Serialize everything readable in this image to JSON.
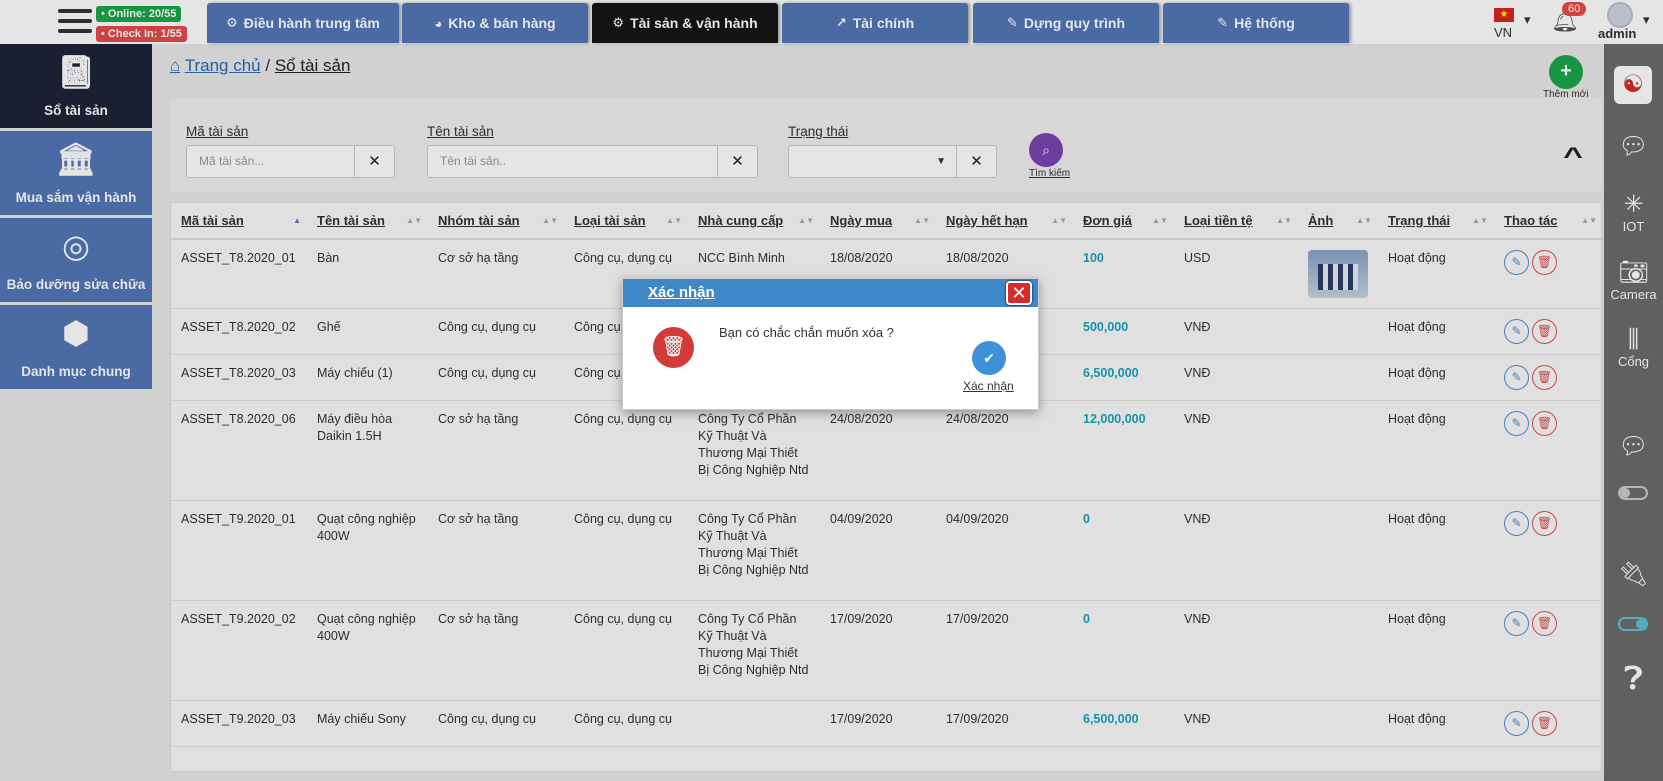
{
  "topbar": {
    "online": "• Online: 20/55",
    "checkin": "• Check In: 1/55",
    "tabs": [
      {
        "label": "Điều hành trung tâm",
        "icon": "⚙"
      },
      {
        "label": "Kho & bán hàng",
        "icon": "◕"
      },
      {
        "label": "Tài sản & vận hành",
        "icon": "⚙"
      },
      {
        "label": "Tài chính",
        "icon": "↗"
      },
      {
        "label": "Dựng quy trình",
        "icon": "✎"
      },
      {
        "label": "Hệ thống",
        "icon": "✎"
      }
    ],
    "lang": "VN",
    "notif_count": "60",
    "user": "admin"
  },
  "sidebar": {
    "items": [
      {
        "label": "Sổ tài sản",
        "icon": "book-icon"
      },
      {
        "label": "Mua sắm vận hành",
        "icon": "bank-icon"
      },
      {
        "label": "Bảo dưỡng sửa chữa",
        "icon": "lifebuoy-icon"
      },
      {
        "label": "Danh mục chung",
        "icon": "cubes-icon"
      }
    ]
  },
  "rail": {
    "iot": "IOT",
    "camera": "Camera",
    "gate": "Cổng"
  },
  "breadcrumb": {
    "home": "Trang chủ",
    "current": "Sổ tài sản"
  },
  "add": {
    "label": "Thêm mới"
  },
  "filters": {
    "code_label": "Mã tài sản",
    "code_placeholder": "Mã tài sản...",
    "name_label": "Tên tài sản",
    "name_placeholder": "Tên tài sản..",
    "status_label": "Trạng thái",
    "search_label": "Tìm kiếm"
  },
  "table": {
    "headers": [
      "Mã tài sản",
      "Tên tài sản",
      "Nhóm tài sản",
      "Loại tài sản",
      "Nhà cung cấp",
      "Ngày mua",
      "Ngày hết hạn",
      "Đơn giá",
      "Loại tiền tệ",
      "Ảnh",
      "Trạng thái",
      "Thao tác"
    ],
    "rows": [
      [
        "ASSET_T8.2020_01",
        "Bàn",
        "Cơ sở hạ tầng",
        "Công cụ, dụng cụ",
        "NCC Bình Minh",
        "18/08/2020",
        "18/08/2020",
        "100",
        "USD",
        "",
        "Hoạt động"
      ],
      [
        "ASSET_T8.2020_02",
        "Ghế",
        "Công cụ, dụng cụ",
        "Công cụ, dụng cụ",
        "",
        "",
        "",
        "500,000",
        "VNĐ",
        "",
        "Hoạt động"
      ],
      [
        "ASSET_T8.2020_03",
        "Máy chiếu (1)",
        "Công cụ, dụng cụ",
        "Công cụ, dụng cụ",
        "",
        "",
        "",
        "6,500,000",
        "VNĐ",
        "",
        "Hoạt động"
      ],
      [
        "ASSET_T8.2020_06",
        "Máy điều hòa Daikin 1.5H",
        "Cơ sở hạ tầng",
        "Công cụ, dụng cụ",
        "Công Ty Cổ Phần Kỹ Thuật Và Thương Mại Thiết Bị Công Nghiệp Ntd",
        "24/08/2020",
        "24/08/2020",
        "12,000,000",
        "VNĐ",
        "",
        "Hoạt động"
      ],
      [
        "ASSET_T9.2020_01",
        "Quạt công nghiệp 400W",
        "Cơ sở hạ tầng",
        "Công cụ, dụng cụ",
        "Công Ty Cổ Phần Kỹ Thuật Và Thương Mại Thiết Bị Công Nghiệp Ntd",
        "04/09/2020",
        "04/09/2020",
        "0",
        "VNĐ",
        "",
        "Hoạt động"
      ],
      [
        "ASSET_T9.2020_02",
        "Quạt công nghiệp 400W",
        "Cơ sở hạ tầng",
        "Công cụ, dụng cụ",
        "Công Ty Cổ Phần Kỹ Thuật Và Thương Mại Thiết Bị Công Nghiệp Ntd",
        "17/09/2020",
        "17/09/2020",
        "0",
        "VNĐ",
        "",
        "Hoạt động"
      ],
      [
        "ASSET_T9.2020_03",
        "Máy chiếu Sony",
        "Công cụ, dụng cụ",
        "Công cụ, dụng cụ",
        "",
        "17/09/2020",
        "17/09/2020",
        "6,500,000",
        "VNĐ",
        "",
        "Hoạt động"
      ]
    ]
  },
  "modal": {
    "title": "Xác nhận",
    "message": "Bạn có chắc chắn muốn xóa ?",
    "confirm_label": "Xác nhận"
  }
}
